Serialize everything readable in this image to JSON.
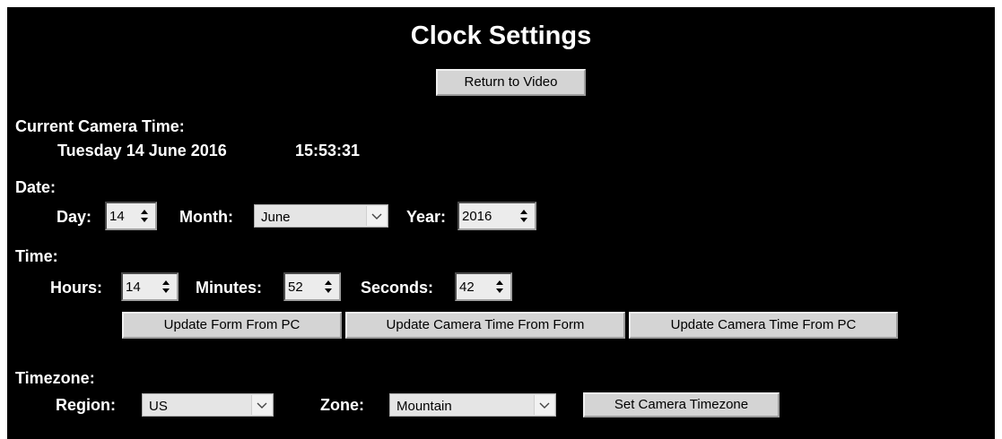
{
  "page": {
    "title": "Clock Settings",
    "return_button": "Return to Video"
  },
  "current_time": {
    "label": "Current Camera Time:",
    "date": "Tuesday 14 June 2016",
    "time": "15:53:31"
  },
  "date_section": {
    "label": "Date:",
    "day_label": "Day:",
    "day_value": "14",
    "month_label": "Month:",
    "month_value": "June",
    "year_label": "Year:",
    "year_value": "2016"
  },
  "time_section": {
    "label": "Time:",
    "hours_label": "Hours:",
    "hours_value": "14",
    "minutes_label": "Minutes:",
    "minutes_value": "52",
    "seconds_label": "Seconds:",
    "seconds_value": "42"
  },
  "actions": {
    "update_form_from_pc": "Update Form From PC",
    "update_camera_from_form": "Update Camera Time From Form",
    "update_camera_from_pc": "Update Camera Time From PC"
  },
  "timezone": {
    "label": "Timezone:",
    "region_label": "Region:",
    "region_value": "US",
    "zone_label": "Zone:",
    "zone_value": "Mountain",
    "set_button": "Set Camera Timezone"
  },
  "icons": {
    "spinner": "spinner-arrows-icon",
    "dropdown": "chevron-down-icon"
  }
}
